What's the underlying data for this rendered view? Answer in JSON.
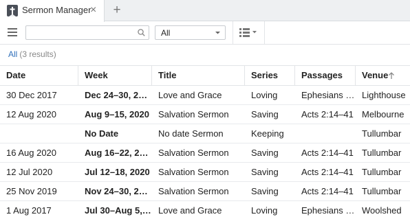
{
  "tab": {
    "title": "Sermon Manager",
    "close_glyph": "×",
    "add_glyph": "+",
    "logo_icon": "book-icon"
  },
  "toolbar": {
    "search": {
      "value": "",
      "placeholder": ""
    },
    "filter": {
      "selected": "All"
    }
  },
  "results": {
    "label": "All",
    "count": "(3 results)"
  },
  "table": {
    "columns": [
      "Date",
      "Week",
      "Title",
      "Series",
      "Passages",
      "Venue"
    ],
    "sort_column": "Venue",
    "sort_direction": "ascending",
    "rows": [
      [
        "30 Dec 2017",
        "Dec 24–30, 20…",
        "Love and Grace",
        "Loving",
        "Ephesians …",
        "Lighthouse"
      ],
      [
        "12 Aug 2020",
        "Aug 9–15, 2020",
        "Salvation Sermon",
        "Saving",
        "Acts 2:14–41",
        "Melbourne"
      ],
      [
        "",
        "No Date",
        "No date Sermon",
        "Keeping",
        "",
        "Tullumbar"
      ],
      [
        "16 Aug 2020",
        "Aug 16–22, 2…",
        "Salvation Sermon",
        "Saving",
        "Acts 2:14–41",
        "Tullumbar"
      ],
      [
        "12 Jul 2020",
        "Jul 12–18, 2020",
        "Salvation Sermon",
        "Saving",
        "Acts 2:14–41",
        "Tullumbar"
      ],
      [
        "25 Nov 2019",
        "Nov 24–30, 2…",
        "Salvation Sermon",
        "Saving",
        "Acts 2:14–41",
        "Tullumbar"
      ],
      [
        "1 Aug 2017",
        "Jul 30–Aug 5,…",
        "Love and Grace",
        "Loving",
        "Ephesians …",
        "Woolshed"
      ]
    ]
  },
  "colors": {
    "link": "#2f6fba",
    "tabbar": "#eef0f2",
    "border": "#e2e4e7"
  }
}
